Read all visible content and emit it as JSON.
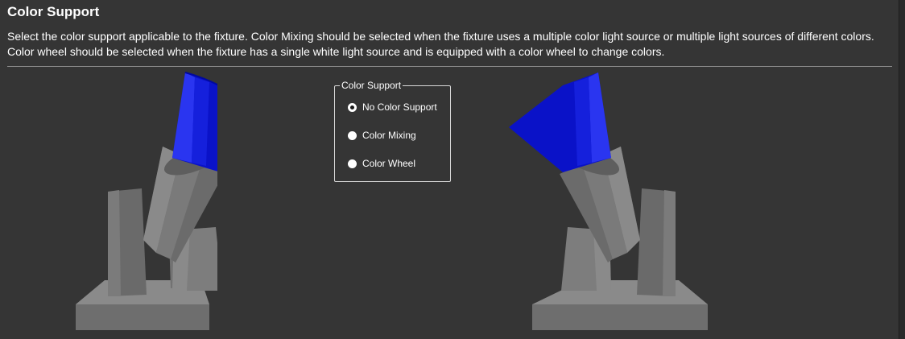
{
  "header": {
    "title": "Color Support"
  },
  "description": "Select the color support applicable to the fixture.  Color Mixing should be selected when the fixture uses a multiple color light source or multiple light sources of different colors.  Color wheel should be selected when the fixture has a single white light source and is equipped with a color wheel to change colors.",
  "group": {
    "legend": "Color Support",
    "options": [
      {
        "label": "No Color Support",
        "selected": true
      },
      {
        "label": "Color Mixing",
        "selected": false
      },
      {
        "label": "Color Wheel",
        "selected": false
      }
    ]
  },
  "colors": {
    "background": "#353535",
    "lens": "#0a14d8",
    "body": "#7a7a7a"
  },
  "icons": {
    "fixture_left": "moving-head-fixture-icon",
    "fixture_right": "moving-head-fixture-icon"
  }
}
